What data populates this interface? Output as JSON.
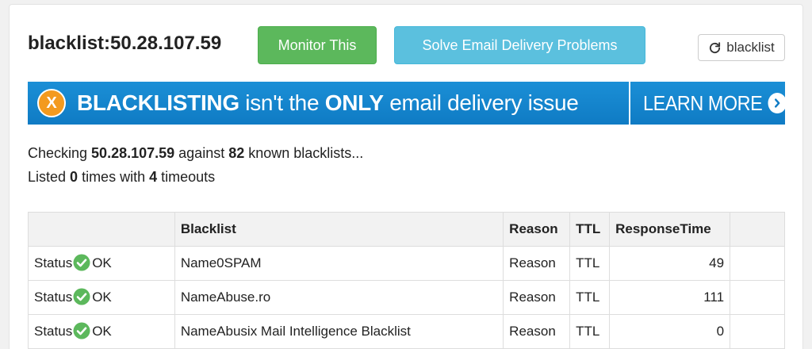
{
  "header": {
    "title": "blacklist:50.28.107.59",
    "monitor_label": "Monitor This",
    "solve_label": "Solve Email Delivery Problems",
    "refresh_label": "blacklist"
  },
  "banner": {
    "part1": "BLACKLISTING",
    "part2": " isn't the ",
    "part3": "ONLY",
    "part4": " email delivery issue",
    "learn_more": "LEARN MORE",
    "x_glyph": "X"
  },
  "summary": {
    "line1_prefix": "Checking ",
    "ip": "50.28.107.59",
    "line1_mid": " against ",
    "count": "82",
    "line1_suffix": " known blacklists...",
    "line2_prefix": "Listed ",
    "listed": "0",
    "line2_mid": " times with ",
    "timeouts": "4",
    "line2_suffix": " timeouts"
  },
  "table": {
    "columns": [
      "",
      "Blacklist",
      "Reason",
      "TTL",
      "ResponseTime",
      ""
    ],
    "rows": [
      {
        "status_label": "Status",
        "status": "OK",
        "blacklist": "Name0SPAM",
        "reason": "Reason",
        "ttl": "TTL",
        "response": "49"
      },
      {
        "status_label": "Status",
        "status": "OK",
        "blacklist": "NameAbuse.ro",
        "reason": "Reason",
        "ttl": "TTL",
        "response": "111"
      },
      {
        "status_label": "Status",
        "status": "OK",
        "blacklist": "NameAbusix Mail Intelligence Blacklist",
        "reason": "Reason",
        "ttl": "TTL",
        "response": "0"
      }
    ]
  },
  "colors": {
    "success": "#5cb85c",
    "info": "#5bc0de",
    "banner_blue": "#1b8fd6",
    "banner_orange": "#f39a1f"
  },
  "icons": {
    "refresh": "refresh-icon",
    "status_ok": "check-circle-icon",
    "learn_more": "chevron-right-circle-icon"
  }
}
